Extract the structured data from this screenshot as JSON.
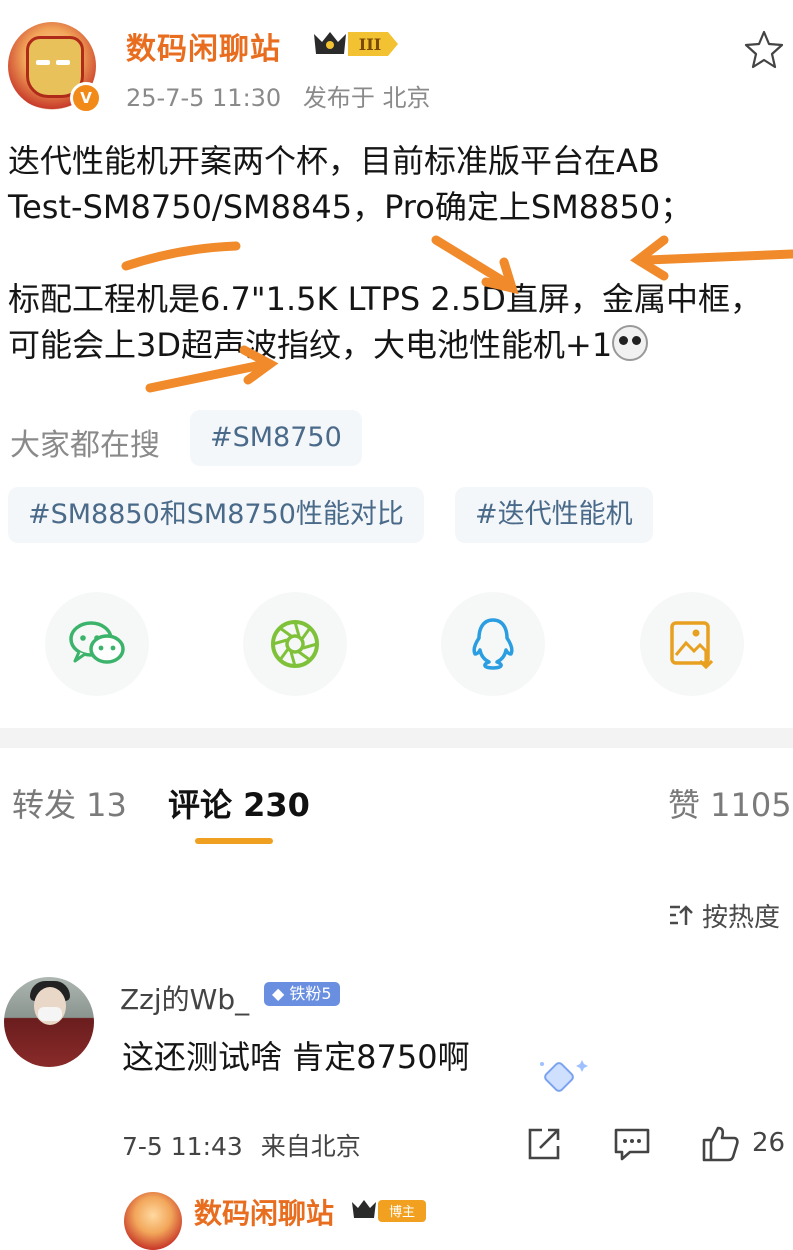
{
  "post": {
    "author": "数码闲聊站",
    "rank_badge": "III",
    "date": "25-7-5 11:30",
    "location": "发布于 北京",
    "verified": "V",
    "lines": [
      "迭代性能机开案两个杯，目前标准版平台在AB",
      "Test-SM8750/SM8845，Pro确定上SM8850；",
      "",
      "标配工程机是6.7\"1.5K LTPS 2.5D直屏，金属中框，",
      "可能会上3D超声波指纹，大电池性能机+1"
    ],
    "annotation_color": "#f08a2a"
  },
  "search": {
    "label": "大家都在搜",
    "tags": [
      "#SM8750",
      "#SM8850和SM8750性能对比",
      "#迭代性能机"
    ]
  },
  "share": {
    "icons": [
      "wechat-icon",
      "moments-icon",
      "qq-icon",
      "save-image-icon"
    ]
  },
  "tabs": {
    "repost": "转发 13",
    "comments": "评论 230",
    "likes": "赞 1105"
  },
  "sort": {
    "label": "按热度"
  },
  "comment": {
    "user": "Zzj的Wb_",
    "fan_badge": "铁粉5",
    "text": "这还测试啥  肯定8750啊",
    "time": "7-5 11:43",
    "location": "来自北京",
    "like_count": "26"
  },
  "reply": {
    "author": "数码闲聊站",
    "badge": "博主"
  },
  "colors": {
    "brand_orange": "#e86d1f",
    "tab_accent": "#f0a020",
    "tag_text": "#4a6a8a"
  }
}
